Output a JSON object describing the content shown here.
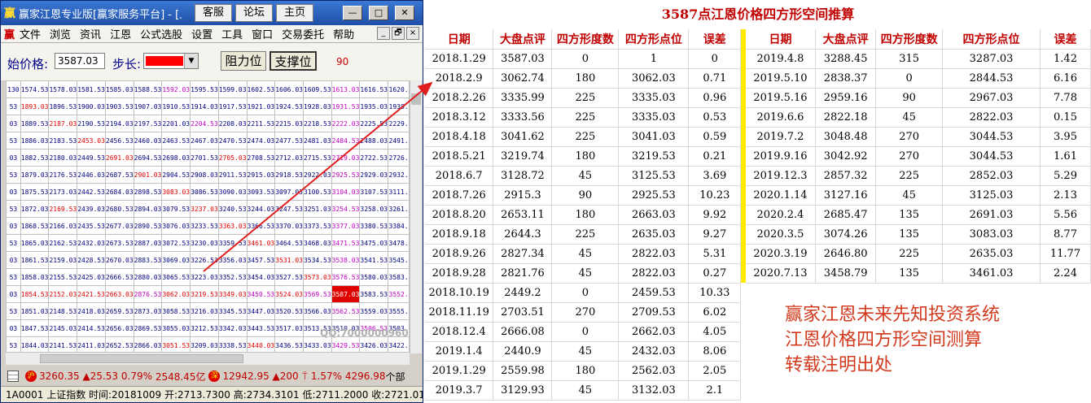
{
  "window": {
    "title": "赢家江恩专业版[赢家服务平台] - [上证指",
    "logo": "赢",
    "top_buttons": [
      "客服",
      "论坛",
      "主页"
    ],
    "controls": [
      "—",
      "□",
      "✕"
    ]
  },
  "menu": {
    "items": [
      "文件",
      "浏览",
      "资讯",
      "江恩",
      "公式选股",
      "设置",
      "工具",
      "窗口",
      "交易委托",
      "帮助"
    ],
    "mdi": [
      "_",
      "🗗",
      "×"
    ]
  },
  "toolbar": {
    "start_label": "始价格:",
    "start_value": "3587.03",
    "step_label": "步长:",
    "step_color": "#ff0000",
    "resist_btn": "阻力位",
    "support_btn": "支撑位",
    "count": "90"
  },
  "grid": {
    "rows": [
      [
        "130",
        "1574.53",
        "1578.03",
        "1581.53",
        "1585.03",
        "1588.53",
        "1592.03",
        "1595.53",
        "1599.03",
        "1602.53",
        "1606.03",
        "1609.53",
        "1613.03",
        "1616.53",
        "1620."
      ],
      [
        "53",
        "1893.03",
        "1896.53",
        "1900.03",
        "1903.53",
        "1907.03",
        "1910.53",
        "1914.03",
        "1917.53",
        "1921.03",
        "1924.53",
        "1928.03",
        "1931.53",
        "1935.03",
        "1938."
      ],
      [
        "03",
        "1889.53",
        "2187.03",
        "2190.53",
        "2194.03",
        "2197.53",
        "2201.03",
        "2204.53",
        "2208.03",
        "2211.53",
        "2215.03",
        "2218.53",
        "2222.03",
        "2225.53",
        "2229."
      ],
      [
        "53",
        "1886.03",
        "2183.53",
        "2453.03",
        "2456.53",
        "2460.03",
        "2463.53",
        "2467.03",
        "2470.53",
        "2474.03",
        "2477.53",
        "2481.03",
        "2484.53",
        "2488.03",
        "2491."
      ],
      [
        "03",
        "1882.53",
        "2180.03",
        "2449.53",
        "2691.03",
        "2694.53",
        "2698.03",
        "2701.53",
        "2705.03",
        "2708.53",
        "2712.03",
        "2715.53",
        "2719.03",
        "2722.53",
        "2726."
      ],
      [
        "53",
        "1879.03",
        "2176.53",
        "2446.03",
        "2687.53",
        "2901.03",
        "2904.53",
        "2908.03",
        "2911.53",
        "2915.03",
        "2918.53",
        "2922.03",
        "2925.53",
        "2929.03",
        "2932."
      ],
      [
        "03",
        "1875.53",
        "2173.03",
        "2442.53",
        "2684.03",
        "2898.53",
        "3083.03",
        "3086.53",
        "3090.03",
        "3093.53",
        "3097.03",
        "3100.53",
        "3104.03",
        "3107.53",
        "3111."
      ],
      [
        "53",
        "1872.03",
        "2169.53",
        "2439.03",
        "2680.53",
        "2894.03",
        "3079.53",
        "3237.03",
        "3240.53",
        "3244.03",
        "3247.53",
        "3251.03",
        "3254.53",
        "3258.03",
        "3261."
      ],
      [
        "03",
        "1868.53",
        "2166.03",
        "2435.53",
        "2677.03",
        "2890.53",
        "3076.03",
        "3233.53",
        "3363.03",
        "3366.53",
        "3370.03",
        "3373.53",
        "3377.03",
        "3380.53",
        "3384."
      ],
      [
        "53",
        "1865.03",
        "2162.53",
        "2432.03",
        "2673.53",
        "2887.03",
        "3072.53",
        "3230.03",
        "3359.53",
        "3461.03",
        "3464.53",
        "3468.03",
        "3471.53",
        "3475.03",
        "3478."
      ],
      [
        "03",
        "1861.53",
        "2159.03",
        "2428.53",
        "2670.03",
        "2883.53",
        "3069.03",
        "3226.53",
        "3356.03",
        "3457.53",
        "3531.03",
        "3534.53",
        "3538.03",
        "3541.53",
        "3545."
      ],
      [
        "53",
        "1858.03",
        "2155.53",
        "2425.03",
        "2666.53",
        "2880.03",
        "3065.53",
        "3223.03",
        "3352.53",
        "3454.03",
        "3527.53",
        "3573.03",
        "3576.53",
        "3580.03",
        "3583."
      ],
      [
        "03",
        "1854.53",
        "2152.03",
        "2421.53",
        "2663.03",
        "2876.53",
        "3062.03",
        "3219.53",
        "3349.03",
        "3450.53",
        "3524.03",
        "3569.53",
        "3587.03",
        "3583.53",
        "3552."
      ],
      [
        "53",
        "1851.03",
        "2148.53",
        "2418.03",
        "2659.53",
        "2873.03",
        "3058.53",
        "3216.03",
        "3345.53",
        "3447.03",
        "3520.53",
        "3566.03",
        "3562.53",
        "3559.03",
        "3555."
      ],
      [
        "03",
        "1847.53",
        "2145.03",
        "2414.53",
        "2656.03",
        "2869.53",
        "3055.03",
        "3212.53",
        "3342.03",
        "3443.53",
        "3517.03",
        "3513.53",
        "3510.03",
        "3506.53",
        "3503."
      ],
      [
        "53",
        "1844.03",
        "2141.53",
        "2411.03",
        "2652.53",
        "2866.03",
        "3051.53",
        "3209.03",
        "3338.53",
        "3440.03",
        "3436.53",
        "3433.03",
        "3429.53",
        "3426.03",
        "3422."
      ],
      [
        "03",
        "1840.53",
        "2138.03",
        "2407.53",
        "2649.03",
        "2862.53",
        "3048.03",
        "3205.53",
        "3335.03",
        "3331.53",
        "3328.03",
        "3324.53",
        "3321.03",
        "3317.53",
        "3314."
      ],
      [
        "53",
        "1837.03",
        "2134.53",
        "2404.03",
        "2645.53",
        "2859.03",
        "3044.53",
        "3202.03",
        "3198.53",
        "3195.03",
        "3191.53",
        "3188.03",
        "3184.53",
        "3181.03",
        "3177."
      ]
    ]
  },
  "status": {
    "sh_index": "3260.35",
    "sh_change": "▲25.53",
    "sh_pct": "0.79%",
    "sh_amount": "2548.45亿",
    "sz_index": "12942.95",
    "sz_change": "▲200",
    "sz_pct": "1.57%",
    "sz_amount": "4296.98",
    "tail": "个部"
  },
  "info": "1A0001 上证指数 时间:20181009 开:2713.7300 高:2734.3101 低:2711.2000 收:2721.0100",
  "watermark": "QQ:7000000960",
  "right": {
    "title": "3587点江恩价格四方形空间推算",
    "headers": [
      "日期",
      "大盘点评",
      "四方形度数",
      "四方形点位",
      "误差"
    ],
    "left_rows": [
      [
        "2018.1.29",
        "3587.03",
        "0",
        "1",
        "0"
      ],
      [
        "2018.2.9",
        "3062.74",
        "180",
        "3062.03",
        "0.71"
      ],
      [
        "2018.2.26",
        "3335.99",
        "225",
        "3335.03",
        "0.96"
      ],
      [
        "2018.3.12",
        "3333.56",
        "225",
        "3335.03",
        "0.53"
      ],
      [
        "2018.4.18",
        "3041.62",
        "225",
        "3041.03",
        "0.59"
      ],
      [
        "2018.5.21",
        "3219.74",
        "180",
        "3219.53",
        "0.21"
      ],
      [
        "2018.6.7",
        "3128.72",
        "45",
        "3125.53",
        "3.69"
      ],
      [
        "2018.7.26",
        "2915.3",
        "90",
        "2925.53",
        "10.23"
      ],
      [
        "2018.8.20",
        "2653.11",
        "180",
        "2663.03",
        "9.92"
      ],
      [
        "2018.9.18",
        "2644.3",
        "225",
        "2635.03",
        "9.27"
      ],
      [
        "2018.9.26",
        "2827.34",
        "45",
        "2822.03",
        "5.31"
      ],
      [
        "2018.9.28",
        "2821.76",
        "45",
        "2822.03",
        "0.27"
      ],
      [
        "2018.10.19",
        "2449.2",
        "0",
        "2459.53",
        "10.33"
      ],
      [
        "2018.11.19",
        "2703.51",
        "270",
        "2709.53",
        "6.02"
      ],
      [
        "2018.12.4",
        "2666.08",
        "0",
        "2662.03",
        "4.05"
      ],
      [
        "2019.1.4",
        "2440.9",
        "45",
        "2432.03",
        "8.06"
      ],
      [
        "2019.1.29",
        "2559.98",
        "180",
        "2562.03",
        "2.05"
      ],
      [
        "2019.3.7",
        "3129.93",
        "45",
        "3132.03",
        "2.1"
      ]
    ],
    "right_rows": [
      [
        "2019.4.8",
        "3288.45",
        "315",
        "3287.03",
        "1.42"
      ],
      [
        "2019.5.10",
        "2838.37",
        "0",
        "2844.53",
        "6.16"
      ],
      [
        "2019.5.16",
        "2959.16",
        "90",
        "2967.03",
        "7.78"
      ],
      [
        "2019.6.6",
        "2822.18",
        "45",
        "2822.03",
        "0.15"
      ],
      [
        "2019.7.2",
        "3048.48",
        "270",
        "3044.53",
        "3.95"
      ],
      [
        "2019.9.16",
        "3042.92",
        "270",
        "3044.53",
        "1.61"
      ],
      [
        "2019.12.3",
        "2857.32",
        "225",
        "2852.03",
        "5.29"
      ],
      [
        "2020.1.14",
        "3127.16",
        "45",
        "3125.03",
        "2.13"
      ],
      [
        "2020.2.4",
        "2685.47",
        "135",
        "2691.03",
        "5.56"
      ],
      [
        "2020.3.5",
        "3074.26",
        "135",
        "3083.03",
        "8.77"
      ],
      [
        "2020.3.19",
        "2646.80",
        "225",
        "2635.03",
        "11.77"
      ],
      [
        "2020.7.13",
        "3458.79",
        "135",
        "3461.03",
        "2.24"
      ]
    ],
    "note": [
      "赢家江恩未来先知投资系统",
      "江恩价格四方形空间测算",
      "转载注明出处"
    ]
  },
  "colors": {
    "accent": "#c00000",
    "divider": "#ffea00",
    "note": "#d23a1e"
  }
}
